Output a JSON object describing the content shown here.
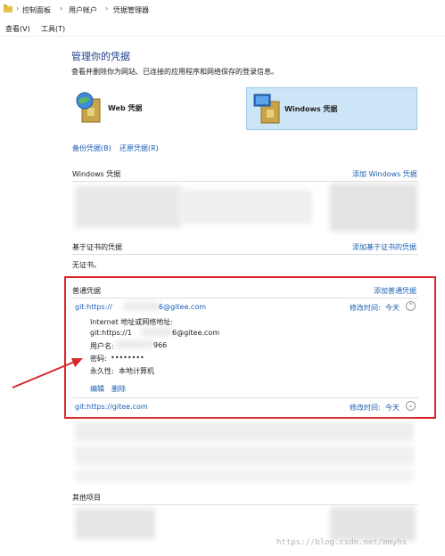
{
  "breadcrumb": {
    "items": [
      "控制面板",
      "用户帐户",
      "凭据管理器"
    ]
  },
  "menu": {
    "view": "查看(V)",
    "tools": "工具(T)"
  },
  "page": {
    "title": "管理你的凭据",
    "description": "查看并删除你为网站、已连接的应用程序和网络保存的登录信息。",
    "web_tab": "Web 凭据",
    "windows_tab": "Windows 凭据",
    "backup_link": "备份凭据(B)",
    "restore_link": "还原凭据(R)"
  },
  "windows_section": {
    "title": "Windows 凭据",
    "add": "添加 Windows 凭据"
  },
  "cert_section": {
    "title": "基于证书的凭据",
    "add": "添加基于证书的凭据",
    "empty": "无证书。"
  },
  "generic_section": {
    "title": "普通凭据",
    "add": "添加普通凭据",
    "item1": {
      "name_prefix": "git:https://",
      "name_suffix": "6@gitee.com",
      "modified_label": "修改时间:",
      "modified_value": "今天",
      "addr_label": "Internet 地址或网络地址:",
      "addr_prefix": "git:https://1",
      "addr_suffix": "6@gitee.com",
      "user_label": "用户名:",
      "user_suffix": "966",
      "pwd_label": "密码:",
      "pwd_value": "••••••••",
      "persist_label": "永久性:",
      "persist_value": "本地计算机",
      "edit": "编辑",
      "delete": "删除"
    },
    "item2": {
      "name": "git:https://gitee.com",
      "modified_label": "修改时间:",
      "modified_value": "今天"
    }
  },
  "other_section": {
    "title": "其他项目"
  },
  "watermark": "https://blog.csdn.net/mmyhs",
  "colors": {
    "link": "#1a5fb4",
    "highlight_box": "#d9262b",
    "tab_selected_bg": "#cde6f7",
    "tab_selected_border": "#99c9ea"
  }
}
